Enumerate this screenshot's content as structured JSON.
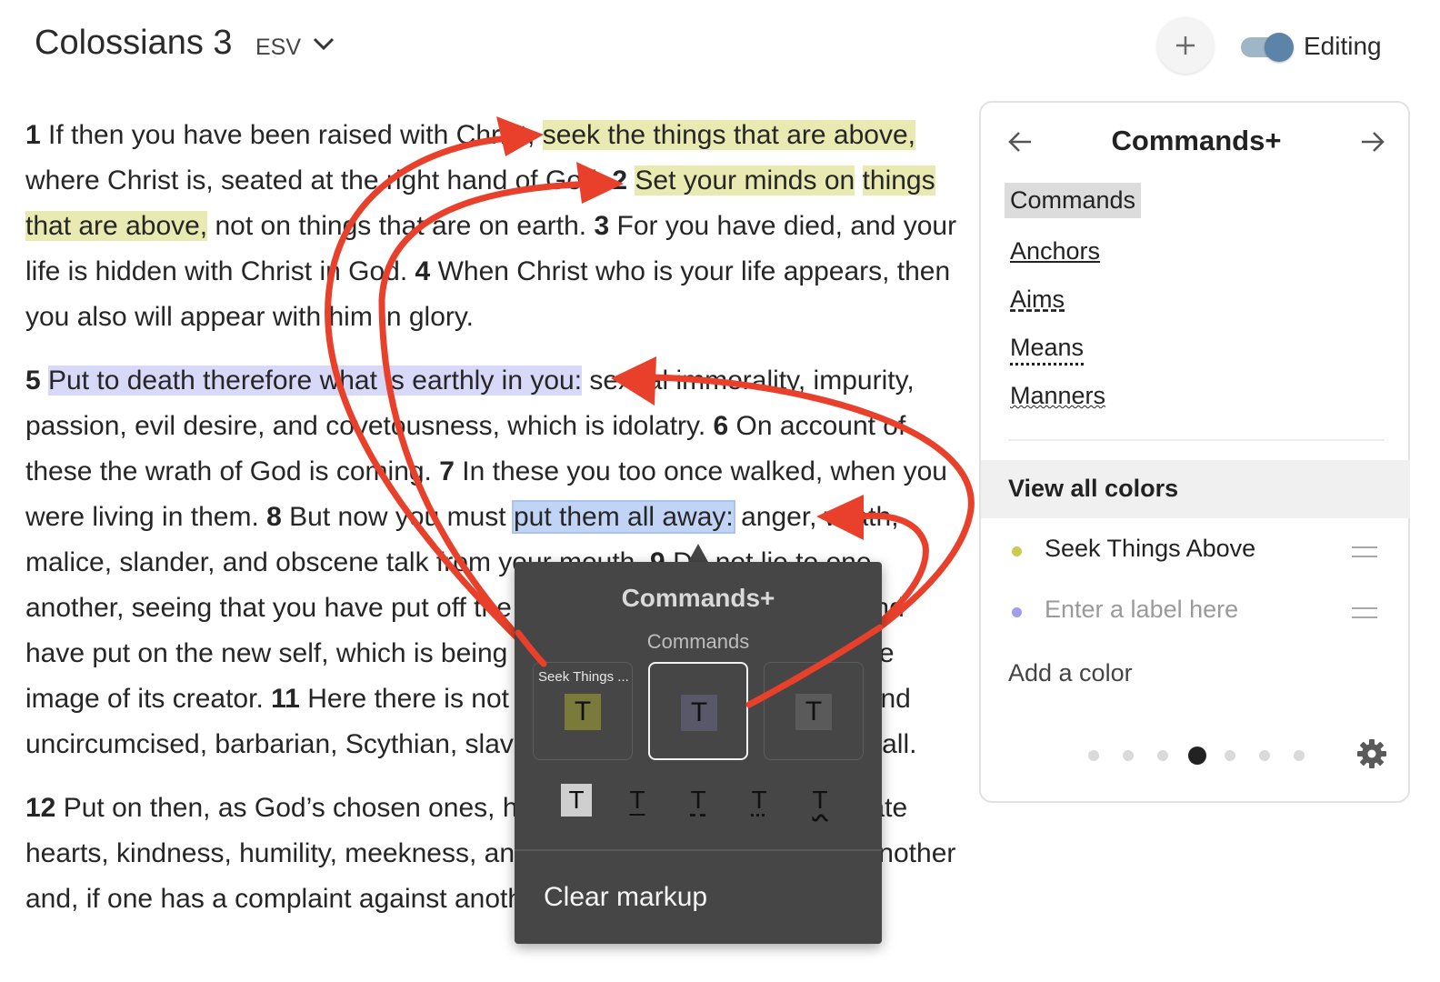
{
  "header": {
    "title": "Colossians 3",
    "version": "ESV",
    "editing_label": "Editing"
  },
  "passage": {
    "v1_num": "1",
    "v1_a": "If then you have been raised with Christ,",
    "v1_hl": "seek the things that are above,",
    "v1_b": "where Christ is, seated at the right hand of God.",
    "v2_num": "2",
    "v2_hl_a": "Set your minds on",
    "v2_hl_b": "things that are above,",
    "v2_b": "not on things that are on earth.",
    "v3_num": "3",
    "v3": "For you have died, and your life is hidden with Christ in God.",
    "v4_num": "4",
    "v4": "When Christ who is your life appears, then you also will appear with him in glory.",
    "v5_num": "5",
    "v5_hl": "Put to death therefore what is earthly in you:",
    "v5_b": "sexual immorality, impurity, passion, evil desire, and covetousness, which is idolatry.",
    "v6_num": "6",
    "v6": "On account of these the wrath of God is coming.",
    "v7_num": "7",
    "v7": "In these you too once walked, when you were living in them.",
    "v8_num": "8",
    "v8_a": "But now you must",
    "v8_hl": "put them all away:",
    "v8_b": "anger, wrath, malice, slander, and obscene talk from your mouth.",
    "v9_num": "9",
    "v9": "Do not lie to one another, seeing that you have put off the old self with its practices",
    "v10_num": "10",
    "v10": "and have put on the new self, which is being renewed in knowledge after the image of its creator.",
    "v11_num": "11",
    "v11": "Here there is not Greek and Jew, circumcised and uncircumcised, barbarian, Scythian, slave, free; but Christ is all, and in all.",
    "v12_num": "12",
    "v12": "Put on then, as God’s chosen ones, holy and beloved, compassionate hearts, kindness, humility, meekness, and patience, bearing with one another and, if one has a complaint against another, forgiving each other;"
  },
  "popup": {
    "title": "Commands+",
    "subtitle": "Commands",
    "swatches": [
      {
        "label": "Seek Things ...",
        "glyph": "T",
        "color": "#7a7a3a"
      },
      {
        "label": "",
        "glyph": "T",
        "color": "#585868"
      },
      {
        "label": "",
        "glyph": "T",
        "color": "#5a5a5a"
      }
    ],
    "styles": [
      "T",
      "T",
      "T",
      "T",
      "T"
    ],
    "clear_label": "Clear markup"
  },
  "panel": {
    "title": "Commands+",
    "categories": [
      "Commands",
      "Anchors",
      "Aims",
      "Means",
      "Manners"
    ],
    "view_all": "View all colors",
    "colors": [
      {
        "label": "Seek Things Above",
        "dot": "#c9cc4e",
        "placeholder": false
      },
      {
        "label": "Enter a label here",
        "dot": "#9ea0ea",
        "placeholder": true
      }
    ],
    "add_color": "Add a color",
    "pager": {
      "count": 7,
      "active": 4
    }
  },
  "colors": {
    "yellow_highlight": "#e8eab2",
    "lavender_highlight": "#d8d8f8",
    "blue_highlight": "#c2d4f6",
    "arrow": "#e8402a",
    "popup_bg": "#464646"
  }
}
